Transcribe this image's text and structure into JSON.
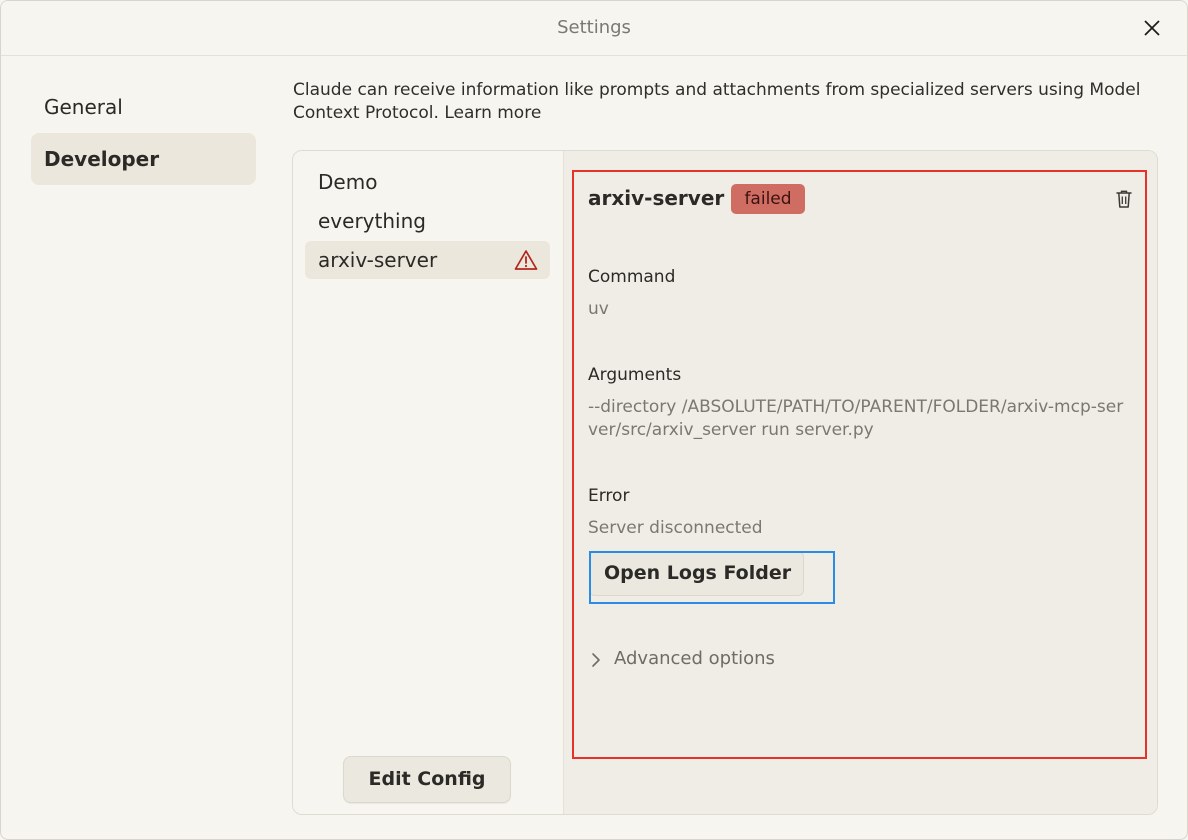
{
  "window": {
    "title": "Settings"
  },
  "nav": {
    "items": [
      {
        "label": "General",
        "active": false
      },
      {
        "label": "Developer",
        "active": true
      }
    ]
  },
  "description": {
    "text": "Claude can receive information like prompts and attachments from specialized servers using Model Context Protocol.",
    "link": "Learn more"
  },
  "servers": {
    "items": [
      {
        "name": "Demo",
        "selected": false,
        "warning": false
      },
      {
        "name": "everything",
        "selected": false,
        "warning": false
      },
      {
        "name": "arxiv-server",
        "selected": true,
        "warning": true
      }
    ],
    "edit_config_label": "Edit Config"
  },
  "detail": {
    "server_name": "arxiv-server",
    "status": "failed",
    "command_label": "Command",
    "command_value": "uv",
    "arguments_label": "Arguments",
    "arguments_value": "--directory /ABSOLUTE/PATH/TO/PARENT/FOLDER/arxiv-mcp-server/src/arxiv_server run server.py",
    "error_label": "Error",
    "error_value": "Server disconnected",
    "open_logs_label": "Open Logs Folder",
    "advanced_label": "Advanced options"
  },
  "colors": {
    "background": "#f7f5f0",
    "badge_failed": "#d06d63",
    "highlight_red": "#e5332a",
    "highlight_blue": "#2a8ce6",
    "warning_icon": "#b3261e"
  },
  "icons": {
    "close": "close-icon",
    "warning": "warning-triangle-icon",
    "trash": "trash-icon",
    "chevron": "chevron-right-icon"
  }
}
